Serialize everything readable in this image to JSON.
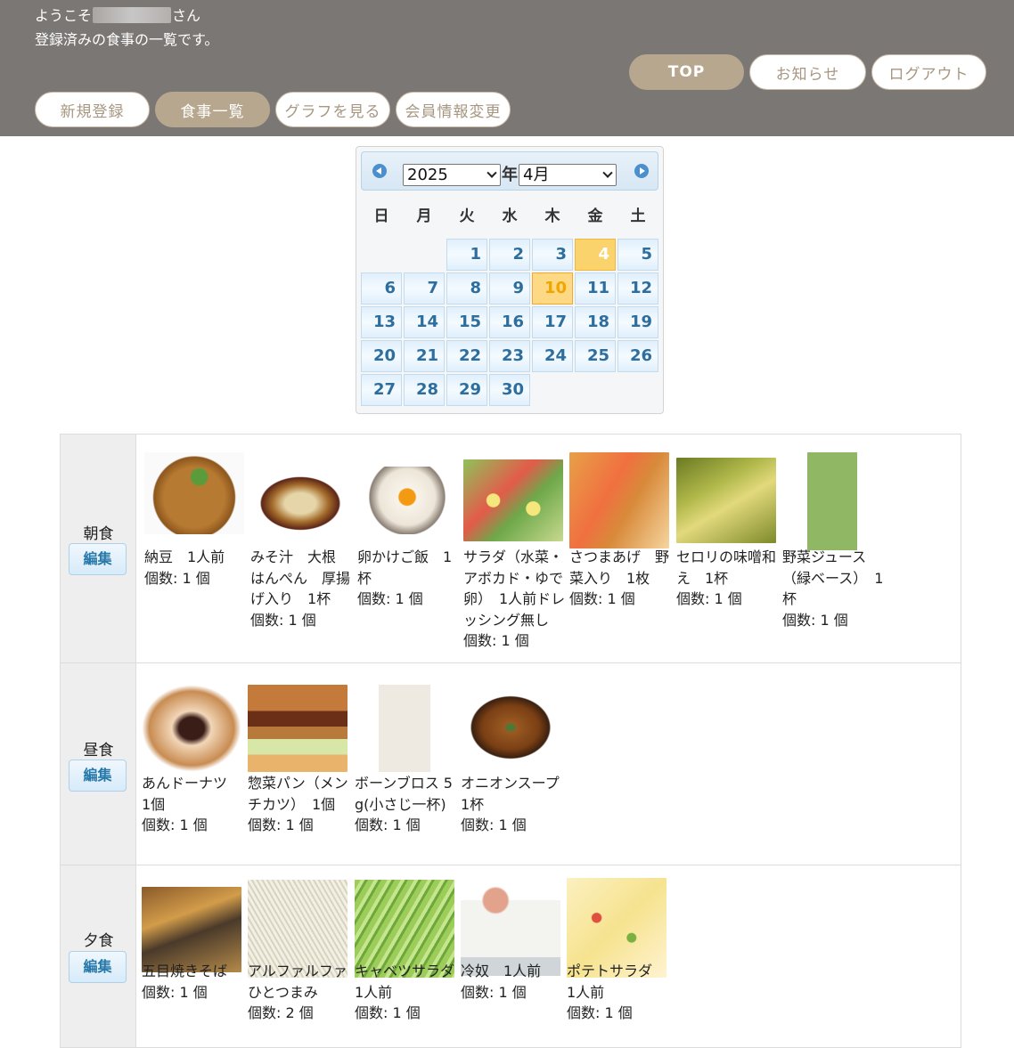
{
  "header": {
    "welcome_prefix": "ようこそ",
    "welcome_suffix": "さん",
    "subtitle": "登録済みの食事の一覧です。",
    "nav_top": "TOP",
    "nav_news": "お知らせ",
    "nav_logout": "ログアウト",
    "nav_register": "新規登録",
    "nav_list": "食事一覧",
    "nav_graph": "グラフを見る",
    "nav_member": "会員情報変更"
  },
  "calendar": {
    "year": "2025",
    "year_suffix": "年",
    "month": "4月",
    "weekdays": [
      "日",
      "月",
      "火",
      "水",
      "木",
      "金",
      "土"
    ],
    "days": [
      "1",
      "2",
      "3",
      "4",
      "5",
      "6",
      "7",
      "8",
      "9",
      "10",
      "11",
      "12",
      "13",
      "14",
      "15",
      "16",
      "17",
      "18",
      "19",
      "20",
      "21",
      "22",
      "23",
      "24",
      "25",
      "26",
      "27",
      "28",
      "29",
      "30"
    ],
    "selected_day": "4",
    "today": "10"
  },
  "meals": [
    {
      "name": "朝食",
      "edit_label": "編集",
      "items": [
        {
          "label": "納豆　1人前",
          "count": "個数: 1 個",
          "image": "natto-photo"
        },
        {
          "label": "みそ汁　大根　はんぺん　厚揚げ入り　1杯",
          "count": "個数: 1 個",
          "image": "miso-soup-photo"
        },
        {
          "label": "卵かけご飯　1杯",
          "count": "個数: 1 個",
          "image": "tamago-kake-gohan-photo"
        },
        {
          "label": "サラダ（水菜・アボカド・ゆで卵）　1人前ドレッシング無し",
          "count": "個数: 1 個",
          "image": "salad-photo"
        },
        {
          "label": "さつまあげ　野菜入り　1枚",
          "count": "個数: 1 個",
          "image": "satsuma-age-photo"
        },
        {
          "label": "セロリの味噌和え　1杯",
          "count": "個数: 1 個",
          "image": "celery-miso-photo"
        },
        {
          "label": "野菜ジュース（緑ベース）　1杯",
          "count": "個数: 1 個",
          "image": "green-juice-photo"
        }
      ]
    },
    {
      "name": "昼食",
      "edit_label": "編集",
      "items": [
        {
          "label": "あんドーナツ　1個",
          "count": "個数: 1 個",
          "image": "an-donut-photo"
        },
        {
          "label": "惣菜パン（メンチカツ）　1個",
          "count": "個数: 1 個",
          "image": "menchi-katsu-pan-photo"
        },
        {
          "label": "ボーンブロス 5g(小さじ一杯)",
          "count": "個数: 1 個",
          "image": "bone-broth-pack-photo"
        },
        {
          "label": "オニオンスープ 1杯",
          "count": "個数: 1 個",
          "image": "onion-soup-photo"
        }
      ]
    },
    {
      "name": "夕食",
      "edit_label": "編集",
      "items": [
        {
          "label": "五目焼きそば",
          "count": "個数: 1 個",
          "image": "gomoku-yakisoba-photo"
        },
        {
          "label": "アルファルファ ひとつまみ",
          "count": "個数: 2 個",
          "image": "alfalfa-photo"
        },
        {
          "label": "キャベツサラダ　1人前",
          "count": "個数: 1 個",
          "image": "cabbage-salad-photo"
        },
        {
          "label": "冷奴　1人前",
          "count": "個数: 1 個",
          "image": "hiyayakko-photo"
        },
        {
          "label": "ポテトサラダ　1人前",
          "count": "個数: 1 個",
          "image": "potato-salad-photo"
        }
      ]
    }
  ]
}
